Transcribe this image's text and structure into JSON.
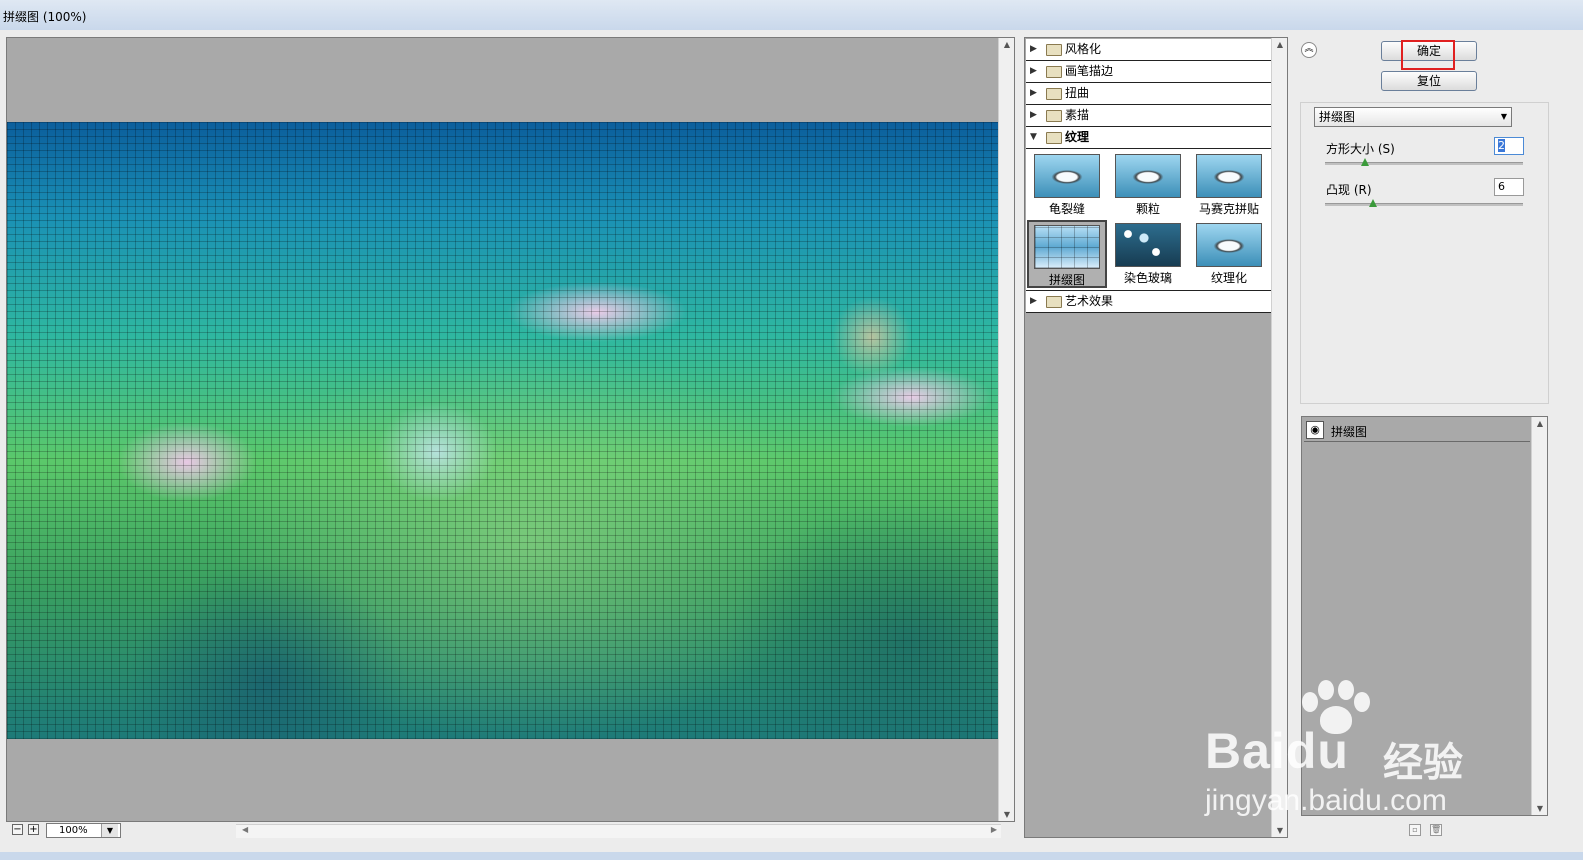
{
  "window": {
    "title": "拼缀图 (100%)"
  },
  "preview": {
    "zoom": "100%",
    "zoom_out_symbol": "−",
    "zoom_in_symbol": "+"
  },
  "gallery": {
    "categories_top": [
      {
        "label": "风格化"
      },
      {
        "label": "画笔描边"
      },
      {
        "label": "扭曲"
      },
      {
        "label": "素描"
      }
    ],
    "open_category": {
      "label": "纹理"
    },
    "thumbnails": [
      {
        "label": "龟裂缝"
      },
      {
        "label": "颗粒"
      },
      {
        "label": "马赛克拼贴"
      },
      {
        "label": "拼缀图"
      },
      {
        "label": "染色玻璃"
      },
      {
        "label": "纹理化"
      }
    ],
    "categories_bottom": [
      {
        "label": "艺术效果"
      }
    ]
  },
  "actions": {
    "ok_label": "确定",
    "reset_label": "复位"
  },
  "settings": {
    "filter_select": "拼缀图",
    "params": [
      {
        "label": "方形大小 (S)",
        "value": "2",
        "level": 0.2
      },
      {
        "label": "凸现 (R)",
        "value": "6",
        "level": 0.24
      }
    ]
  },
  "layers": {
    "items": [
      {
        "name": "拼缀图"
      }
    ]
  },
  "watermark": {
    "brand": "Bai",
    "brand_suffix": "du",
    "brand_cn": "经验",
    "url": "jingyan.baidu.com"
  }
}
